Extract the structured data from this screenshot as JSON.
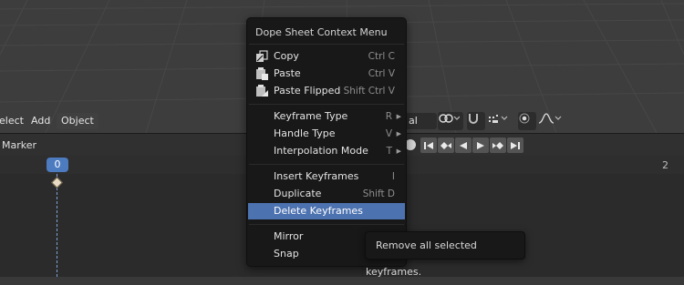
{
  "viewport_header": {
    "select_label": "elect",
    "add_label": "Add",
    "object_label": "Object",
    "mode_label": "al"
  },
  "dopesheet": {
    "marker_label": "Marker",
    "current_frame": "0",
    "frame_label_right": "2"
  },
  "context_menu": {
    "title": "Dope Sheet Context Menu",
    "items": [
      {
        "label": "Copy",
        "shortcut": "Ctrl C",
        "icon": "copy-icon"
      },
      {
        "label": "Paste",
        "shortcut": "Ctrl V",
        "icon": "paste-icon"
      },
      {
        "label": "Paste Flipped",
        "shortcut": "Shift Ctrl V",
        "icon": "paste-flipped-icon"
      },
      {
        "label": "Keyframe Type",
        "shortcut": "R",
        "submenu": true
      },
      {
        "label": "Handle Type",
        "shortcut": "V",
        "submenu": true
      },
      {
        "label": "Interpolation Mode",
        "shortcut": "T",
        "submenu": true
      },
      {
        "label": "Insert Keyframes",
        "shortcut": "I"
      },
      {
        "label": "Duplicate",
        "shortcut": "Shift D"
      },
      {
        "label": "Delete Keyframes",
        "shortcut": "",
        "active": true
      },
      {
        "label": "Mirror",
        "shortcut": ""
      },
      {
        "label": "Snap",
        "shortcut": ""
      }
    ]
  },
  "tooltip": {
    "text": "Remove all selected keyframes."
  },
  "colors": {
    "accent": "#4c72b0",
    "current_frame_bg": "#4d7bc0",
    "menu_bg": "#181818"
  }
}
